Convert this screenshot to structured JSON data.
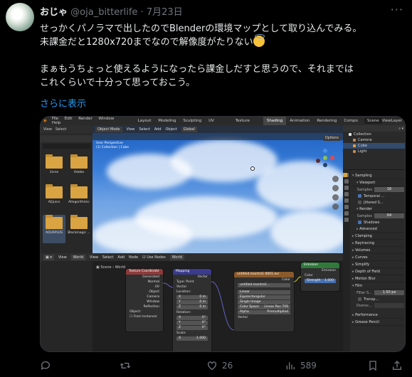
{
  "tweet": {
    "display_name": "おじゃ",
    "handle": "@oja_bitterlife",
    "separator": "·",
    "date": "7月23日",
    "more": "···",
    "lines": [
      "せっかくパノラマで出したのでBlenderの環境マップとして取り込んでみる。",
      "未課金だと1280x720までなので解像度がたりない",
      "",
      "まぁもうちょっと使えるようになったら課金しだすと思うので、それまでは",
      "これくらいで十分って思っておこう。"
    ],
    "show_more": "さらに表示"
  },
  "actions": {
    "reply_count": "",
    "retweet_count": "",
    "like_count": "26",
    "view_count": "589"
  },
  "blender": {
    "menus": [
      "File",
      "Edit",
      "Render",
      "Window",
      "Help"
    ],
    "workspaces": [
      "Layout",
      "Modeling",
      "Sculpting",
      "UV Editing",
      "Texture Paint",
      "Shading",
      "Animation",
      "Rendering",
      "Compo"
    ],
    "active_workspace": "Shading",
    "scene": "Scene",
    "view_layer": "ViewLayer",
    "filebrowser": {
      "menus": [
        "View",
        "Select"
      ],
      "folders": [
        "3ivne",
        "Adobe",
        "AEJuice",
        "Allegorithmic",
        "AQUAPLUS",
        "Blackmagic ..."
      ],
      "selected": "AQUAPLUS"
    },
    "viewport": {
      "mode": "Object Mode",
      "menus": [
        "View",
        "Select",
        "Add",
        "Object"
      ],
      "orientation": "Global",
      "info_line1": "User Perspective",
      "info_line2": "(1) Collection | Cube",
      "options": "Options"
    },
    "outliner": {
      "rows": [
        {
          "label": "Collection",
          "color": "#e6e6e6"
        },
        {
          "label": "Camera",
          "color": "#c28a5a"
        },
        {
          "label": "Cube",
          "color": "#e0a040"
        },
        {
          "label": "Light",
          "color": "#c28a5a"
        }
      ]
    },
    "properties": {
      "sampling": "Sampling",
      "viewport": "Viewport",
      "samples_label": "Samples",
      "viewport_samples": "16",
      "temporal": "Temporal ...",
      "jittered": "Jittered S...",
      "render": "Render",
      "render_samples": "64",
      "shadows": "Shadows",
      "advanced": "Advanced",
      "sections": [
        "Clamping",
        "Raytracing",
        "Volumes",
        "Curves",
        "Simplify",
        "Depth of Field",
        "Motion Blur",
        "Film"
      ],
      "filter_label": "Filter S...",
      "filter_value": "1.50 px",
      "transp": "Transp...",
      "overscan": "Oversc...",
      "performance": "Performance",
      "grease": "Grease Pencil"
    },
    "node_editor": {
      "menus": [
        "View",
        "Select",
        "Add",
        "Node"
      ],
      "shader_type": "World",
      "use_nodes": "Use Nodes",
      "world_name": "World",
      "crumb_scene": "Scene",
      "crumb_world": "World",
      "texcoord": {
        "title": "Texture Coordinate",
        "outputs": [
          "Generated",
          "Normal",
          "UV",
          "Object",
          "Camera",
          "Window",
          "Reflection"
        ],
        "object_label": "Object:",
        "from_instancer": "From Instancer"
      },
      "mapping": {
        "title": "Mapping",
        "output": "Vector",
        "type_label": "Type:",
        "type_value": "Point",
        "vector_in": "Vector",
        "location": "Location:",
        "loc": [
          [
            "X",
            "0 m"
          ],
          [
            "Y",
            "0 m"
          ],
          [
            "Z",
            "0 m"
          ]
        ],
        "rotation": "Rotation:",
        "rot": [
          [
            "X",
            "0°"
          ],
          [
            "Y",
            "0°"
          ],
          [
            "Z",
            "0°"
          ]
        ],
        "scale": "Scale:",
        "scale_x": [
          "X",
          "1.000"
        ]
      },
      "envtex": {
        "title": "untitled.mantra1.0001.exr",
        "output": "Color",
        "image": "untitled.mantra1...",
        "options": [
          "Linear",
          "Equirectangular",
          "Single Image"
        ],
        "color_space_label": "Color Space",
        "color_space": "Linear Rec.709",
        "alpha_label": "Alpha",
        "alpha": "Premultiplied",
        "vector_in": "Vector"
      },
      "emission": {
        "title": "Emission",
        "output": "Emission",
        "color": "Color",
        "strength_label": "Strength",
        "strength": "1.000"
      }
    }
  }
}
